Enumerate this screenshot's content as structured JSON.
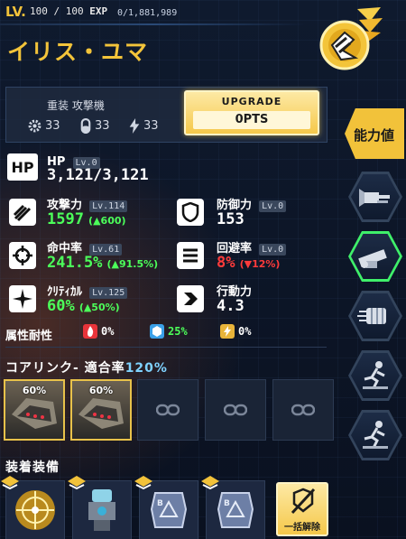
{
  "header": {
    "lv_label": "LV.",
    "level": "100 / 100",
    "exp_label": "EXP",
    "exp_value": "0/1,881,989",
    "character_name": "イリス・ユマ"
  },
  "type_panel": {
    "type_text": "重装 攻撃機",
    "mini_stats": [
      {
        "icon": "gear-icon",
        "value": "33"
      },
      {
        "icon": "capsule-icon",
        "value": "33"
      },
      {
        "icon": "bolt-icon",
        "value": "33"
      }
    ],
    "upgrade_label": "UPGRADE",
    "upgrade_pts": "0PTS"
  },
  "tabs": {
    "active_label": "能力値",
    "items": [
      {
        "name": "tab-weapon-1",
        "icon": "cannon-icon",
        "selected": false
      },
      {
        "name": "tab-weapon-2",
        "icon": "launcher-icon",
        "selected": true
      },
      {
        "name": "tab-fist",
        "icon": "fist-icon",
        "selected": false
      },
      {
        "name": "tab-skill-1",
        "icon": "runner-icon",
        "selected": false
      },
      {
        "name": "tab-skill-2",
        "icon": "runner-icon",
        "selected": false
      }
    ]
  },
  "stats": {
    "hp": {
      "icon_text": "HP",
      "label": "HP",
      "lv": "Lv.0",
      "value": "3,121/3,121"
    },
    "attack": {
      "label": "攻撃力",
      "lv": "Lv.114",
      "value": "1597",
      "delta": "(▲600)"
    },
    "defense": {
      "label": "防御力",
      "lv": "Lv.0",
      "value": "153"
    },
    "accuracy": {
      "label": "命中率",
      "lv": "Lv.61",
      "value": "241.5%",
      "delta": "(▲91.5%)"
    },
    "evasion": {
      "label": "回避率",
      "lv": "Lv.0",
      "value": "8%",
      "delta": "(▼12%)"
    },
    "critical": {
      "label": "ｸﾘﾃｨｶﾙ",
      "lv": "Lv.125",
      "value": "60%",
      "delta": "(▲50%)"
    },
    "action": {
      "label": "行動力",
      "value": "4.3"
    }
  },
  "resist": {
    "label": "属性耐性",
    "items": [
      {
        "icon": "fire-icon",
        "value": "0%",
        "color": "#e8343a"
      },
      {
        "icon": "ice-icon",
        "value": "25%",
        "color": "#3aa0e8"
      },
      {
        "icon": "lightning-icon",
        "value": "0%",
        "color": "#e8b43a"
      }
    ]
  },
  "core_link": {
    "title": "コアリンク- 適合率",
    "rate": "120%",
    "slots": [
      {
        "filled": true,
        "pct": "60%"
      },
      {
        "filled": true,
        "pct": "60%"
      },
      {
        "filled": false,
        "pct": ""
      },
      {
        "filled": false,
        "pct": ""
      },
      {
        "filled": false,
        "pct": ""
      }
    ]
  },
  "equipment": {
    "title": "装着装備",
    "unequip_label": "一括解除",
    "items": [
      {
        "name": "equip-slot-1",
        "icon": "crosshair-chip-icon"
      },
      {
        "name": "equip-slot-2",
        "icon": "robot-part-icon"
      },
      {
        "name": "equip-slot-3",
        "icon": "armor-chip-icon"
      },
      {
        "name": "equip-slot-4",
        "icon": "armor-chip-icon"
      }
    ]
  },
  "colors": {
    "accent": "#f2c23a",
    "buff": "#4cff5a",
    "debuff": "#ff3b3b"
  }
}
